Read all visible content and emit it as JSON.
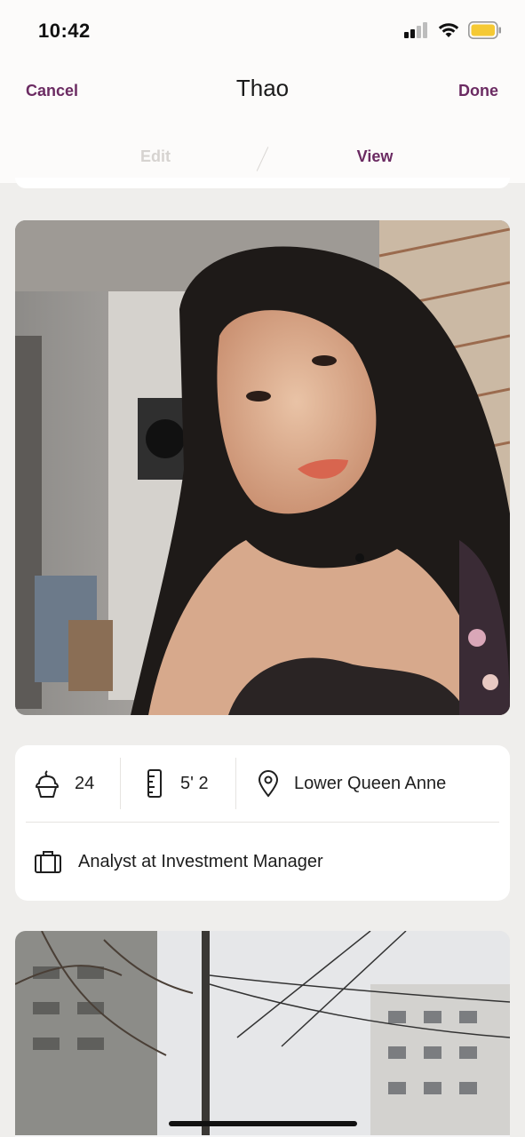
{
  "status_bar": {
    "time": "10:42"
  },
  "header": {
    "title": "Thao",
    "cancel_label": "Cancel",
    "done_label": "Done",
    "tabs": [
      {
        "label": "Edit",
        "active": false
      },
      {
        "label": "View",
        "active": true
      }
    ]
  },
  "profile": {
    "age": "24",
    "height": "5' 2",
    "location": "Lower Queen Anne",
    "job": "Analyst at Investment Manager"
  },
  "icons": {
    "age": "cupcake-icon",
    "height": "ruler-icon",
    "location": "location-pin-icon",
    "job": "briefcase-icon"
  },
  "colors": {
    "accent": "#6b2b62",
    "background": "#efeeec",
    "card": "#ffffff"
  }
}
